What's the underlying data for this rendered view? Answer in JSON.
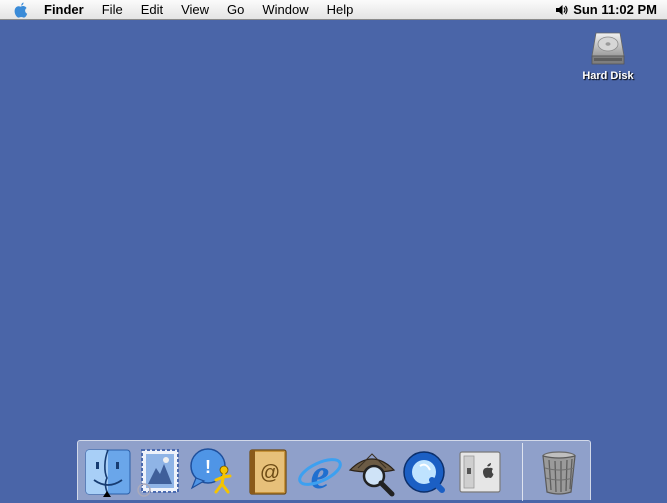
{
  "menubar": {
    "apple_icon": "apple-icon",
    "app_name": "Finder",
    "items": [
      "File",
      "Edit",
      "View",
      "Go",
      "Window",
      "Help"
    ],
    "volume_icon": "speaker-icon",
    "clock": "Sun 11:02 PM"
  },
  "desktop": {
    "background_color": "#4a65a8",
    "icons": [
      {
        "label": "Hard Disk",
        "icon": "hard-disk-icon"
      }
    ]
  },
  "dock": {
    "apps": [
      {
        "icon": "finder-icon",
        "running": true
      },
      {
        "icon": "mail-icon"
      },
      {
        "icon": "aim-icon"
      },
      {
        "icon": "address-book-icon"
      },
      {
        "icon": "internet-explorer-icon"
      },
      {
        "icon": "sherlock-icon"
      },
      {
        "icon": "quicktime-icon"
      },
      {
        "icon": "system-preferences-icon"
      }
    ],
    "trash_icon": "trash-icon"
  }
}
